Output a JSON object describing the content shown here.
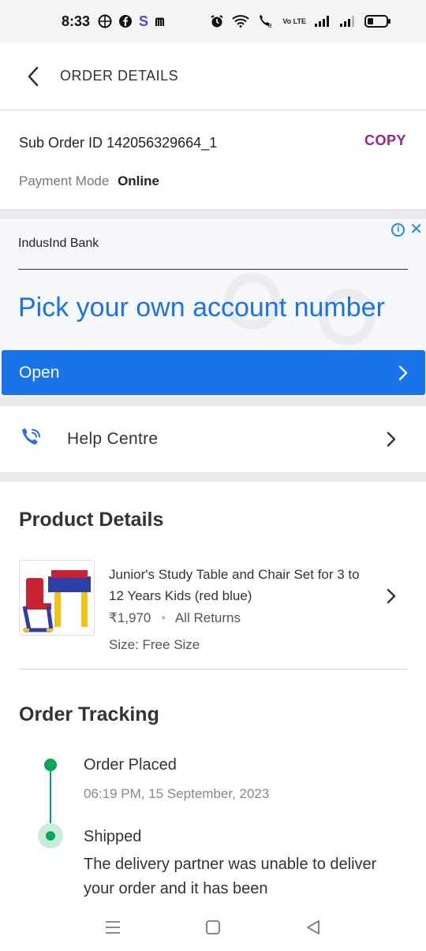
{
  "status_bar": {
    "time": "8:33",
    "left_icons": [
      "soccer-ball-icon",
      "facebook-icon",
      "s-app-icon",
      "m-app-icon"
    ],
    "right_icons": [
      "alarm-icon",
      "wifi-icon",
      "volte-call-icon",
      "signal-icon",
      "signal-icon",
      "battery-icon"
    ],
    "volte_label": "Vo LTE"
  },
  "header": {
    "title": "ORDER DETAILS"
  },
  "sub_order": {
    "label": "Sub Order ID",
    "id": "142056329664_1",
    "copy_label": "COPY",
    "payment_label": "Payment Mode",
    "payment_value": "Online"
  },
  "ad": {
    "brand": "IndusInd Bank",
    "headline": "Pick your own account number",
    "cta": "Open",
    "info_glyph": "i",
    "close_glyph": "✕"
  },
  "help": {
    "label": "Help Centre"
  },
  "product_section": {
    "title": "Product Details",
    "name": "Junior's Study Table and Chair Set for 3 to 12 Years Kids (red blue)",
    "price": "₹1,970",
    "returns": "All Returns",
    "size": "Size: Free Size"
  },
  "tracking": {
    "title": "Order Tracking",
    "steps": [
      {
        "title": "Order Placed",
        "time": "06:19 PM, 15 September, 2023"
      },
      {
        "title": "Shipped",
        "description": "The delivery partner was unable to deliver your order and it has been"
      }
    ]
  },
  "colors": {
    "accent": "#9f2089",
    "ad_blue": "#1a73e8",
    "success_green": "#06a759"
  }
}
